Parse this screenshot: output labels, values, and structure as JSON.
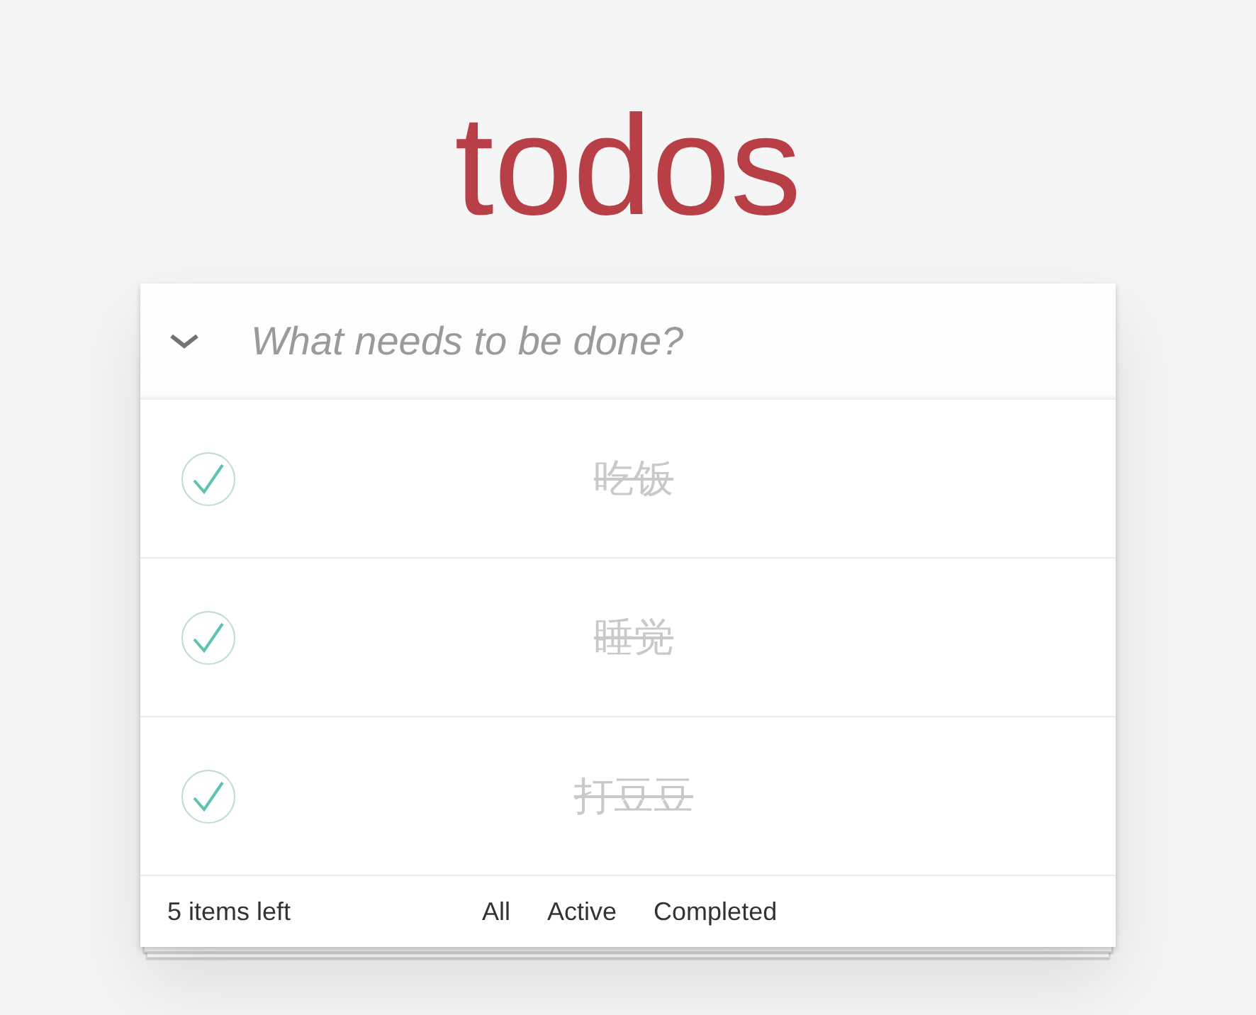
{
  "title": "todos",
  "new_todo": {
    "placeholder": "What needs to be done?"
  },
  "todos": [
    {
      "text": "吃饭",
      "completed": true
    },
    {
      "text": "睡觉",
      "completed": true
    },
    {
      "text": "打豆豆",
      "completed": true
    }
  ],
  "footer": {
    "count": "5 items left",
    "filters": [
      {
        "label": "All",
        "selected": false
      },
      {
        "label": "Active",
        "selected": false
      },
      {
        "label": "Completed",
        "selected": false
      }
    ]
  }
}
